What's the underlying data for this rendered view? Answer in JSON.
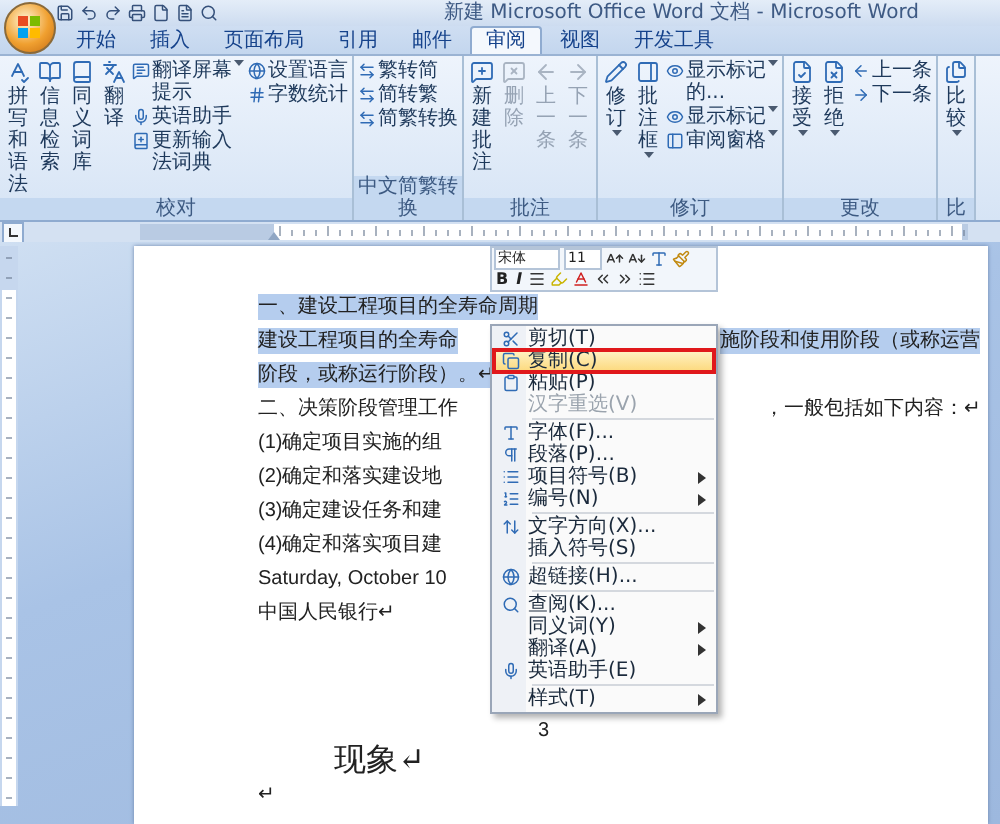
{
  "window": {
    "title": "新建 Microsoft Office Word 文档 - Microsoft Word"
  },
  "tabs": [
    {
      "label": "开始",
      "selected": false
    },
    {
      "label": "插入",
      "selected": false
    },
    {
      "label": "页面布局",
      "selected": false
    },
    {
      "label": "引用",
      "selected": false
    },
    {
      "label": "邮件",
      "selected": false
    },
    {
      "label": "审阅",
      "selected": true
    },
    {
      "label": "视图",
      "selected": false
    },
    {
      "label": "开发工具",
      "selected": false
    }
  ],
  "ribbon_groups": [
    {
      "label": "校对",
      "buttons": [
        {
          "kind": "large",
          "label": "拼写和语法",
          "dropdown": false,
          "disabled": false
        },
        {
          "kind": "large",
          "label": "信息检索",
          "dropdown": false,
          "disabled": false
        },
        {
          "kind": "large",
          "label": "同义词库",
          "dropdown": false,
          "disabled": false
        },
        {
          "kind": "large",
          "label": "翻译",
          "dropdown": false,
          "disabled": false
        },
        {
          "kind": "column",
          "items": [
            {
              "label": "翻译屏幕提示",
              "dropdown": true
            },
            {
              "label": "英语助手",
              "dropdown": false
            },
            {
              "label": "更新输入法词典",
              "dropdown": false
            }
          ]
        },
        {
          "kind": "column",
          "items": [
            {
              "label": "设置语言",
              "dropdown": false
            },
            {
              "label": "字数统计",
              "dropdown": false
            }
          ]
        }
      ]
    },
    {
      "label": "中文简繁转换",
      "buttons": [
        {
          "kind": "column",
          "items": [
            {
              "label": "繁转简",
              "dropdown": false
            },
            {
              "label": "简转繁",
              "dropdown": false
            },
            {
              "label": "简繁转换",
              "dropdown": false
            }
          ]
        }
      ]
    },
    {
      "label": "批注",
      "buttons": [
        {
          "kind": "large",
          "label": "新建批注",
          "dropdown": false,
          "disabled": false
        },
        {
          "kind": "large",
          "label": "删除",
          "dropdown": false,
          "disabled": true
        },
        {
          "kind": "large",
          "label": "上一条",
          "dropdown": false,
          "disabled": true
        },
        {
          "kind": "large",
          "label": "下一条",
          "dropdown": false,
          "disabled": true
        }
      ]
    },
    {
      "label": "修订",
      "buttons": [
        {
          "kind": "large",
          "label": "修订",
          "dropdown": true,
          "disabled": false
        },
        {
          "kind": "large",
          "label": "批注框",
          "dropdown": true,
          "disabled": false
        },
        {
          "kind": "column",
          "items": [
            {
              "label": "显示标记的...",
              "dropdown": true
            },
            {
              "label": "显示标记",
              "dropdown": true
            },
            {
              "label": "审阅窗格",
              "dropdown": true
            }
          ]
        }
      ]
    },
    {
      "label": "更改",
      "buttons": [
        {
          "kind": "large",
          "label": "接受",
          "dropdown": true,
          "disabled": false
        },
        {
          "kind": "large",
          "label": "拒绝",
          "dropdown": true,
          "disabled": false
        },
        {
          "kind": "column",
          "items": [
            {
              "label": "上一条",
              "dropdown": false
            },
            {
              "label": "下一条",
              "dropdown": false
            }
          ]
        }
      ]
    },
    {
      "label": "比",
      "buttons": [
        {
          "kind": "large",
          "label": "比较",
          "dropdown": true,
          "disabled": false
        }
      ]
    }
  ],
  "mini_toolbar": {
    "font": "宋体",
    "size": "11",
    "glyphs": [
      "B",
      "I"
    ]
  },
  "document": {
    "lines": [
      {
        "kind": "body",
        "text": "一、建设工程项目的全寿命周期",
        "selected": true
      },
      {
        "kind": "body",
        "text": "建设工程项目的全寿命",
        "text_right": "施阶段和使用阶段（或称运营",
        "selected": true
      },
      {
        "kind": "body",
        "text": "阶段，或称运行阶段）。↵",
        "selected": true
      },
      {
        "kind": "body",
        "text": "二、决策阶段管理工作",
        "text_right": "，一般包括如下内容：↵",
        "selected": false
      },
      {
        "kind": "body",
        "text": "(1)确定项目实施的组",
        "selected": false
      },
      {
        "kind": "body",
        "text": "(2)确定和落实建设地",
        "selected": false
      },
      {
        "kind": "body",
        "text": "(3)确定建设任务和建",
        "selected": false
      },
      {
        "kind": "body",
        "text": "(4)确定和落实项目建",
        "selected": false
      },
      {
        "kind": "body",
        "text": "Saturday, October 10",
        "selected": false
      },
      {
        "kind": "body",
        "text": "中国人民银行↵",
        "selected": false
      },
      {
        "kind": "page_number",
        "text": "3",
        "selected": false
      },
      {
        "kind": "heading",
        "text": "现象↵",
        "selected": false
      },
      {
        "kind": "body",
        "text": "↵",
        "selected": false
      }
    ]
  },
  "context_menu": {
    "items": [
      {
        "kind": "item",
        "label": "剪切(T)",
        "highlighted": false,
        "disabled": false,
        "submenu": false
      },
      {
        "kind": "item",
        "label": "复制(C)",
        "highlighted": true,
        "disabled": false,
        "submenu": false
      },
      {
        "kind": "item",
        "label": "粘贴(P)",
        "highlighted": false,
        "disabled": false,
        "submenu": false
      },
      {
        "kind": "item",
        "label": "汉字重选(V)",
        "highlighted": false,
        "disabled": true,
        "submenu": false
      },
      {
        "kind": "separator"
      },
      {
        "kind": "item",
        "label": "字体(F)...",
        "highlighted": false,
        "disabled": false,
        "submenu": false
      },
      {
        "kind": "item",
        "label": "段落(P)...",
        "highlighted": false,
        "disabled": false,
        "submenu": false
      },
      {
        "kind": "item",
        "label": "项目符号(B)",
        "highlighted": false,
        "disabled": false,
        "submenu": true
      },
      {
        "kind": "item",
        "label": "编号(N)",
        "highlighted": false,
        "disabled": false,
        "submenu": true
      },
      {
        "kind": "separator"
      },
      {
        "kind": "item",
        "label": "文字方向(X)...",
        "highlighted": false,
        "disabled": false,
        "submenu": false
      },
      {
        "kind": "item",
        "label": "插入符号(S)",
        "highlighted": false,
        "disabled": false,
        "submenu": false
      },
      {
        "kind": "separator"
      },
      {
        "kind": "item",
        "label": "超链接(H)...",
        "highlighted": false,
        "disabled": false,
        "submenu": false
      },
      {
        "kind": "separator"
      },
      {
        "kind": "item",
        "label": "查阅(K)...",
        "highlighted": false,
        "disabled": false,
        "submenu": false
      },
      {
        "kind": "item",
        "label": "同义词(Y)",
        "highlighted": false,
        "disabled": false,
        "submenu": true
      },
      {
        "kind": "item",
        "label": "翻译(A)",
        "highlighted": false,
        "disabled": false,
        "submenu": true
      },
      {
        "kind": "item",
        "label": "英语助手(E)",
        "highlighted": false,
        "disabled": false,
        "submenu": false
      },
      {
        "kind": "separator"
      },
      {
        "kind": "item",
        "label": "样式(T)",
        "highlighted": false,
        "disabled": false,
        "submenu": true
      }
    ]
  }
}
